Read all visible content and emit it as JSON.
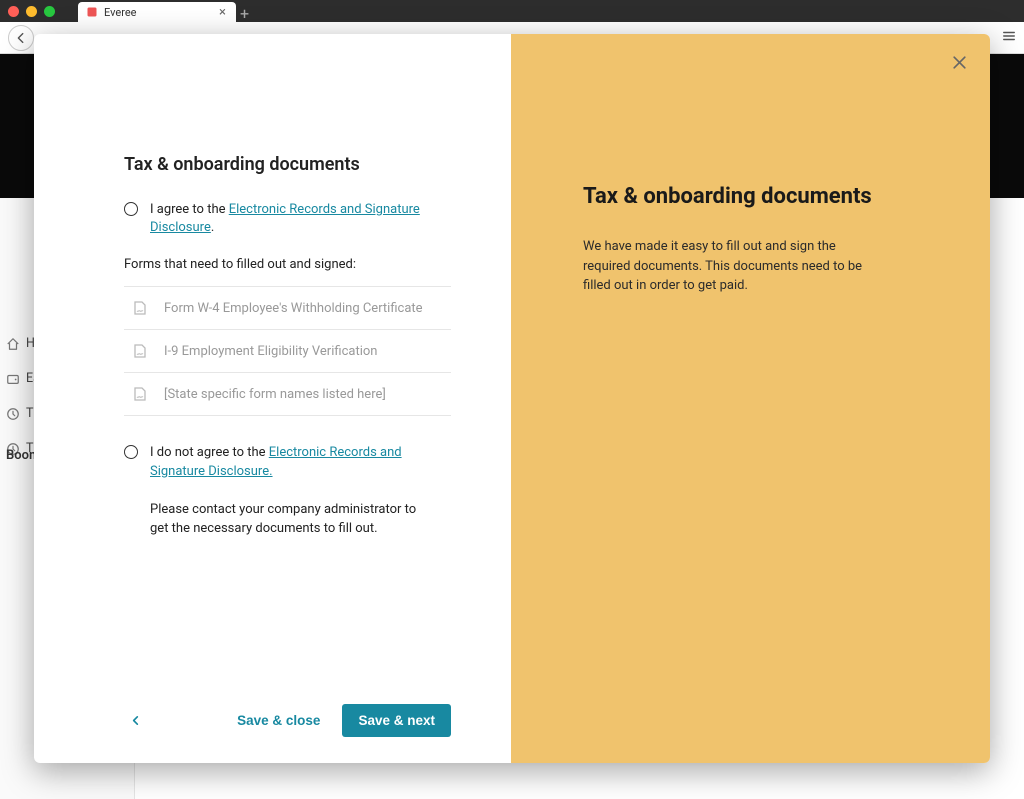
{
  "browser": {
    "tab_title": "Everee",
    "new_tab_symbol": "+",
    "tab_close_symbol": "×"
  },
  "sidebar": {
    "brand": "Boom",
    "items": [
      {
        "label": "Ho",
        "icon": "home"
      },
      {
        "label": "Ea",
        "icon": "wallet"
      },
      {
        "label": "Tim",
        "icon": "clock"
      },
      {
        "label": "Tim",
        "icon": "clock"
      }
    ]
  },
  "modal": {
    "left_title": "Tax & onboarding documents",
    "agree_prefix": "I agree to the ",
    "agree_link": "Electronic Records and Signature Disclosure",
    "agree_suffix": ".",
    "forms_label": "Forms that need to filled out and signed:",
    "forms": [
      "Form W-4 Employee's Withholding Certificate",
      "I-9 Employment Eligibility Verification",
      "[State specific form names listed here]"
    ],
    "disagree_prefix": "I do not agree to the ",
    "disagree_link": "Electronic Records and Signature Disclosure.",
    "contact_note": "Please contact your company administrator to get the necessary documents to fill out.",
    "right_title": "Tax & onboarding documents",
    "right_description": "We have made it easy to fill out and sign the required documents. This documents need to be filled out in order to get paid."
  },
  "footer": {
    "back_symbol": "‹",
    "save_close": "Save & close",
    "save_next": "Save & next"
  }
}
